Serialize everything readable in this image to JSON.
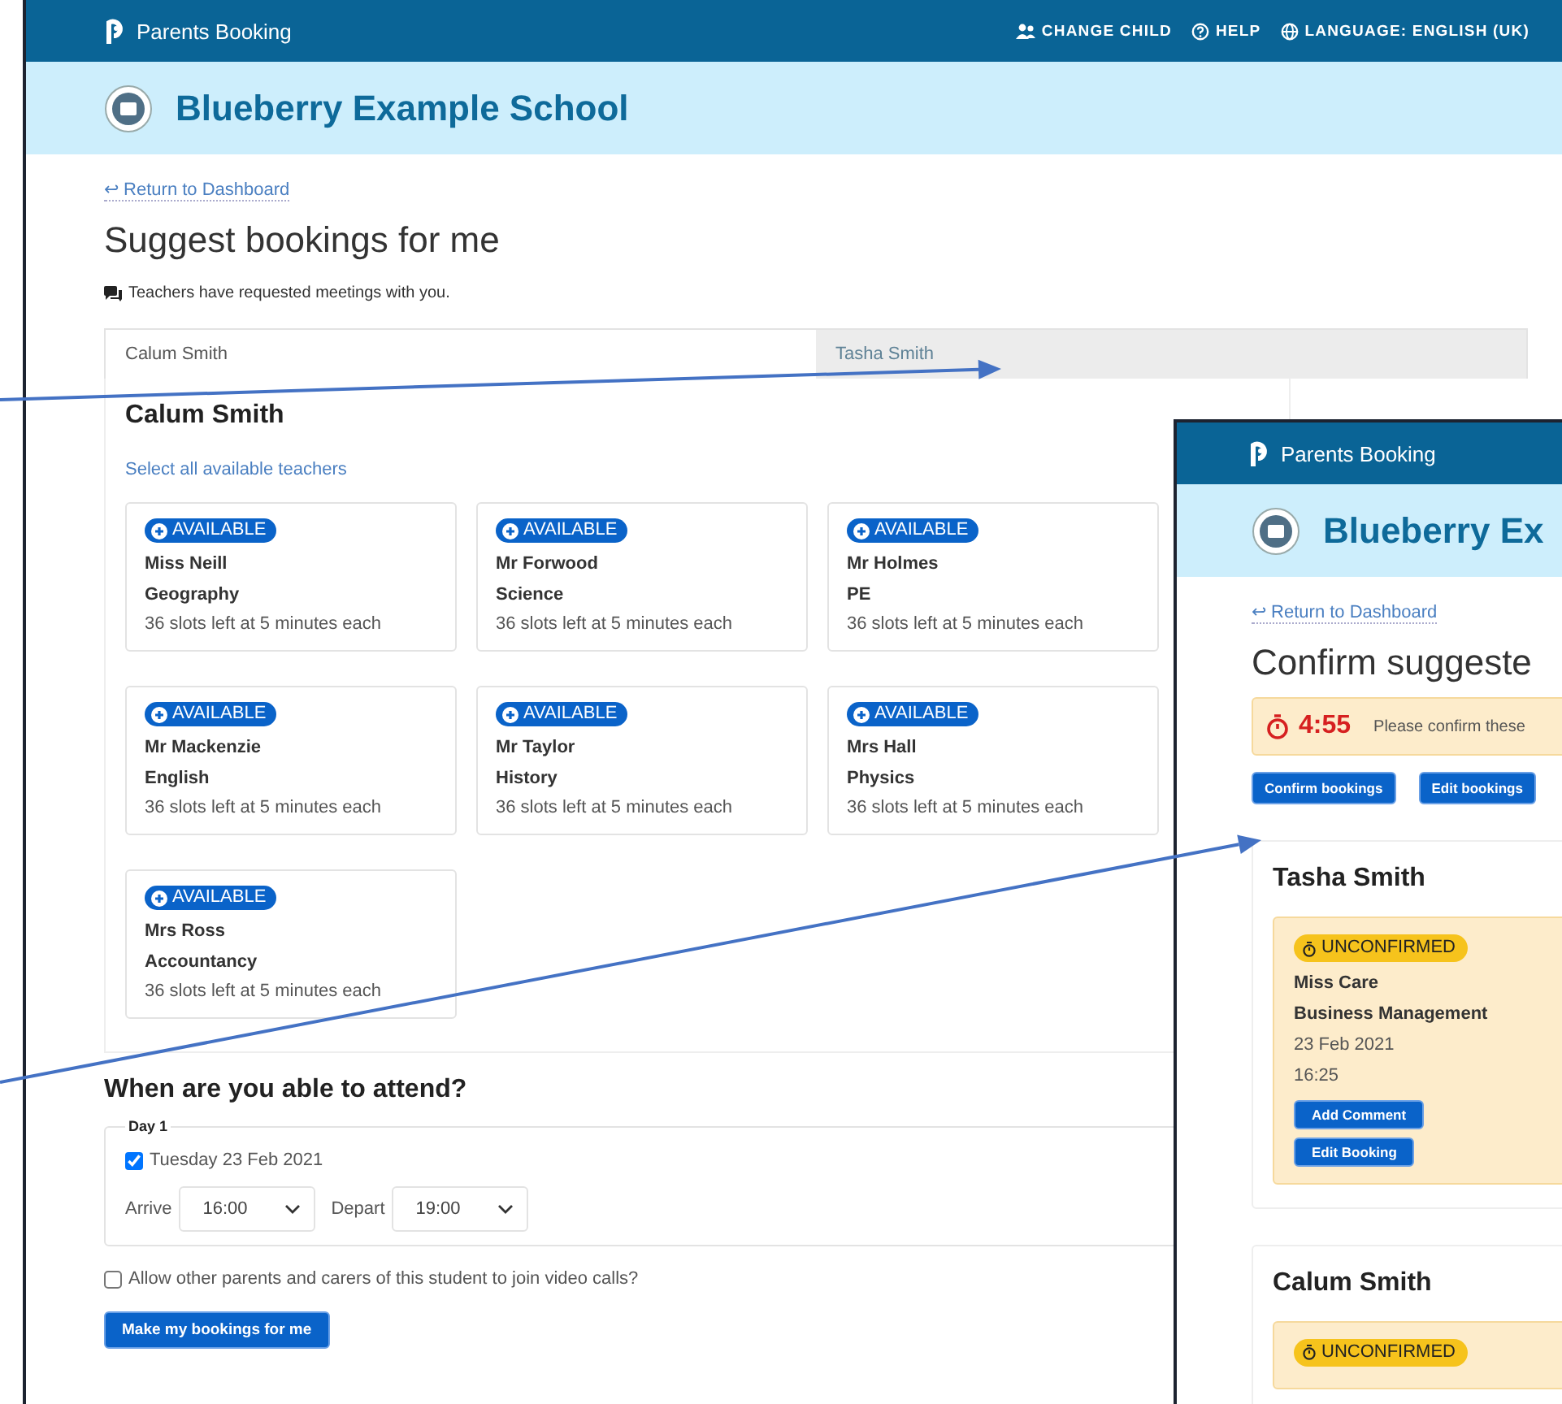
{
  "main_window": {
    "app_name": "Parents Booking",
    "nav": [
      {
        "label": "CHANGE CHILD",
        "kind": "people"
      },
      {
        "label": "HELP",
        "kind": "help"
      },
      {
        "label": "LANGUAGE: ENGLISH (UK)",
        "kind": "globe"
      }
    ],
    "school_name": "Blueberry Example School",
    "back_link": "↩ Return to Dashboard",
    "title": "Suggest bookings for me",
    "notice": "Teachers have requested meetings with you.",
    "tabs": [
      {
        "label": "Calum Smith",
        "selected": true
      },
      {
        "label": "Tasha Smith",
        "selected": false
      }
    ],
    "panel": {
      "heading": "Calum Smith",
      "select_all_link": "Select all available teachers",
      "teachers": [
        {
          "status": "AVAILABLE",
          "name": "Miss Neill",
          "subject": "Geography",
          "slots": "36 slots left at 5 minutes each"
        },
        {
          "status": "AVAILABLE",
          "name": "Mr Forwood",
          "subject": "Science",
          "slots": "36 slots left at 5 minutes each"
        },
        {
          "status": "AVAILABLE",
          "name": "Mr Holmes",
          "subject": "PE",
          "slots": "36 slots left at 5 minutes each"
        },
        {
          "status": "AVAILABLE",
          "name": "Mr Mackenzie",
          "subject": "English",
          "slots": "36 slots left at 5 minutes each"
        },
        {
          "status": "AVAILABLE",
          "name": "Mr Taylor",
          "subject": "History",
          "slots": "36 slots left at 5 minutes each"
        },
        {
          "status": "AVAILABLE",
          "name": "Mrs Hall",
          "subject": "Physics",
          "slots": "36 slots left at 5 minutes each"
        },
        {
          "status": "AVAILABLE",
          "name": "Mrs Ross",
          "subject": "Accountancy",
          "slots": "36 slots left at 5 minutes each"
        }
      ]
    },
    "attendance": {
      "heading": "When are you able to attend?",
      "days": [
        {
          "legend": "Day 1",
          "date": "Tuesday 23 Feb 2021",
          "checked": true,
          "arrive_label": "Arrive",
          "arrive": "16:00",
          "depart_label": "Depart",
          "depart": "19:00"
        }
      ],
      "allow_video": {
        "label": "Allow other parents and carers of this student to join video calls?",
        "checked": false
      },
      "submit": "Make my bookings for me"
    }
  },
  "overlay_window": {
    "app_name": "Parents Booking",
    "school_name": "Blueberry Ex",
    "back_link": "↩ Return to Dashboard",
    "title": "Confirm suggeste",
    "timer": "4:55",
    "alert_text": "Please confirm these",
    "buttons": [
      "Confirm bookings",
      "Edit bookings"
    ],
    "students": [
      {
        "heading": "Tasha Smith",
        "bookings": [
          {
            "status": "UNCONFIRMED",
            "teacher": "Miss Care",
            "subject": "Business Management",
            "date": "23 Feb 2021",
            "time": "16:25",
            "buttons": [
              "Add Comment",
              "Edit Booking"
            ]
          }
        ]
      },
      {
        "heading": "Calum Smith",
        "bookings": [
          {
            "status": "UNCONFIRMED"
          }
        ]
      }
    ]
  }
}
